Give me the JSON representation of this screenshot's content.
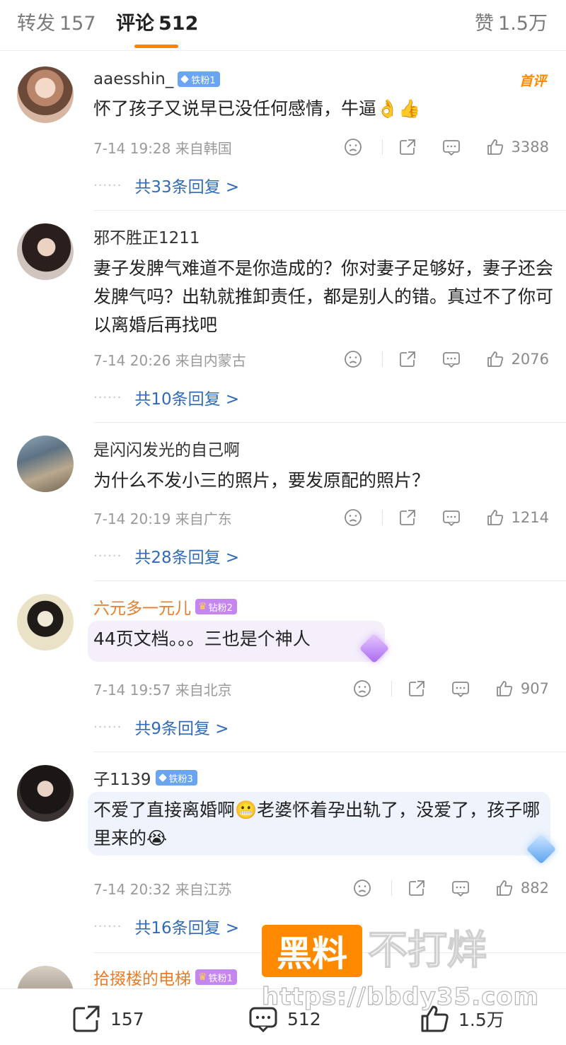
{
  "tabs": {
    "repost_label": "转发",
    "repost_count": "157",
    "comment_label": "评论",
    "comment_count": "512",
    "like_label": "赞",
    "like_count": "1.5万"
  },
  "comments": [
    {
      "username": "aaesshin_",
      "badge": "铁粉1",
      "first_tag": "首评",
      "text": "怀了孩子又说早已没任何感情，牛逼👌👍",
      "time": "7-14 19:28",
      "location": "来自韩国",
      "likes": "3388",
      "replies": "共33条回复 >"
    },
    {
      "username": "邪不胜正1211",
      "text": "妻子发脾气难道不是你造成的？你对妻子足够好，妻子还会发脾气吗？出轨就推卸责任，都是别人的错。真过不了你可以离婚后再找吧",
      "time": "7-14 20:26",
      "location": "来自内蒙古",
      "likes": "2076",
      "replies": "共10条回复 >"
    },
    {
      "username": "是闪闪发光的自己啊",
      "text": "为什么不发小三的照片，要发原配的照片？",
      "time": "7-14 20:19",
      "location": "来自广东",
      "likes": "1214",
      "replies": "共28条回复 >"
    },
    {
      "username": "六元多一元儿",
      "badge": "钻粉2",
      "text": "44页文档。。。三也是个神人",
      "time": "7-14 19:57",
      "location": "来自北京",
      "likes": "907",
      "replies": "共9条回复 >"
    },
    {
      "username": "子1139",
      "badge": "铁粉3",
      "text": "不爱了直接离婚啊😬老婆怀着孕出轨了，没爱了，孩子哪里来的😭",
      "time": "7-14 20:32",
      "location": "来自江苏",
      "likes": "882",
      "replies": "共16条回复 >"
    },
    {
      "username": "拾掇楼的电梯",
      "badge": "铁粉1"
    }
  ],
  "bottom_bar": {
    "repost_count": "157",
    "comment_count": "512",
    "like_count": "1.5万"
  },
  "watermark": {
    "brand": "黑料",
    "tail": "不打烊",
    "url": "https://bbdy35.com"
  },
  "colors": {
    "accent": "#ff8200",
    "link": "#2f6bb8",
    "gold_name": "#e87d2c",
    "badge_blue": "#6aa5f3",
    "badge_purple": "#c586f0"
  },
  "icons": [
    "dislike-icon",
    "share-icon",
    "comment-icon",
    "thumbs-up-icon"
  ]
}
